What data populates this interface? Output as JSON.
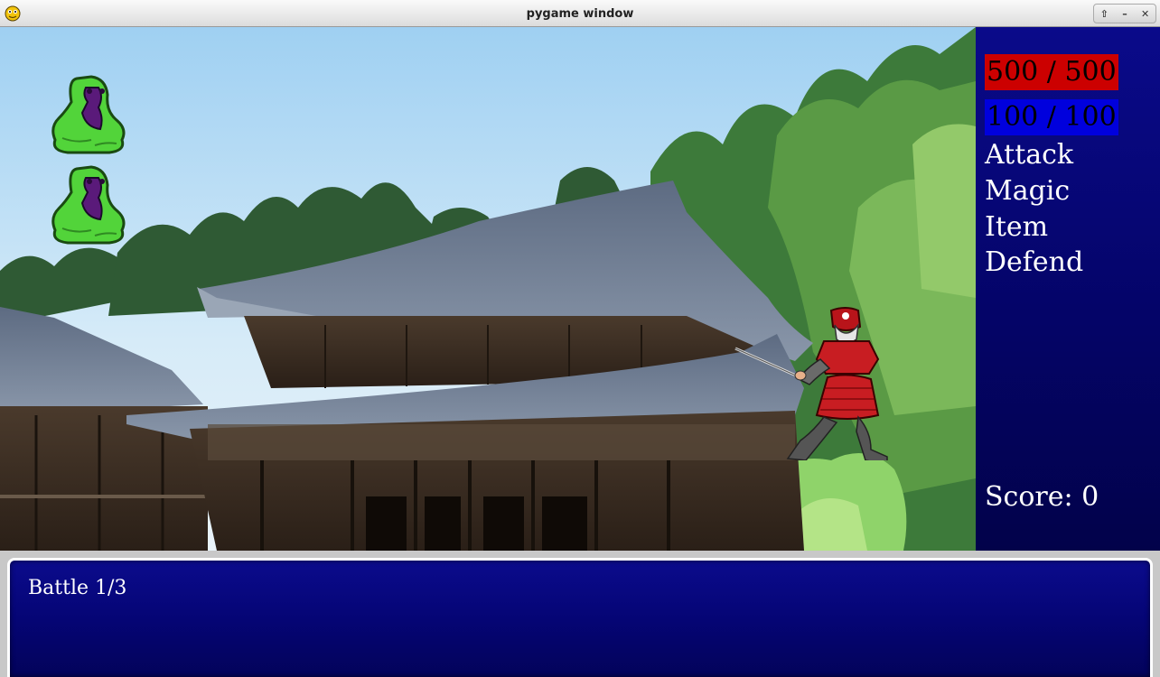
{
  "window": {
    "title": "pygame window",
    "controls": [
      "⇧",
      "–",
      "✕"
    ]
  },
  "player": {
    "hp_text": "500 / 500",
    "mp_text": "100 / 100",
    "hp_fraction": 1.0,
    "mp_fraction": 1.0
  },
  "menu": {
    "items": [
      "Attack",
      "Magic",
      "Item",
      "Defend"
    ]
  },
  "score_text": "Score: 0",
  "message": {
    "text": "Battle 1/3"
  },
  "enemies": [
    {
      "type": "green-slime"
    },
    {
      "type": "green-slime"
    }
  ],
  "colors": {
    "hp": "#cc0000",
    "mp": "#0000dd",
    "panel": "#04047a",
    "sky": "#bfe0f6"
  }
}
